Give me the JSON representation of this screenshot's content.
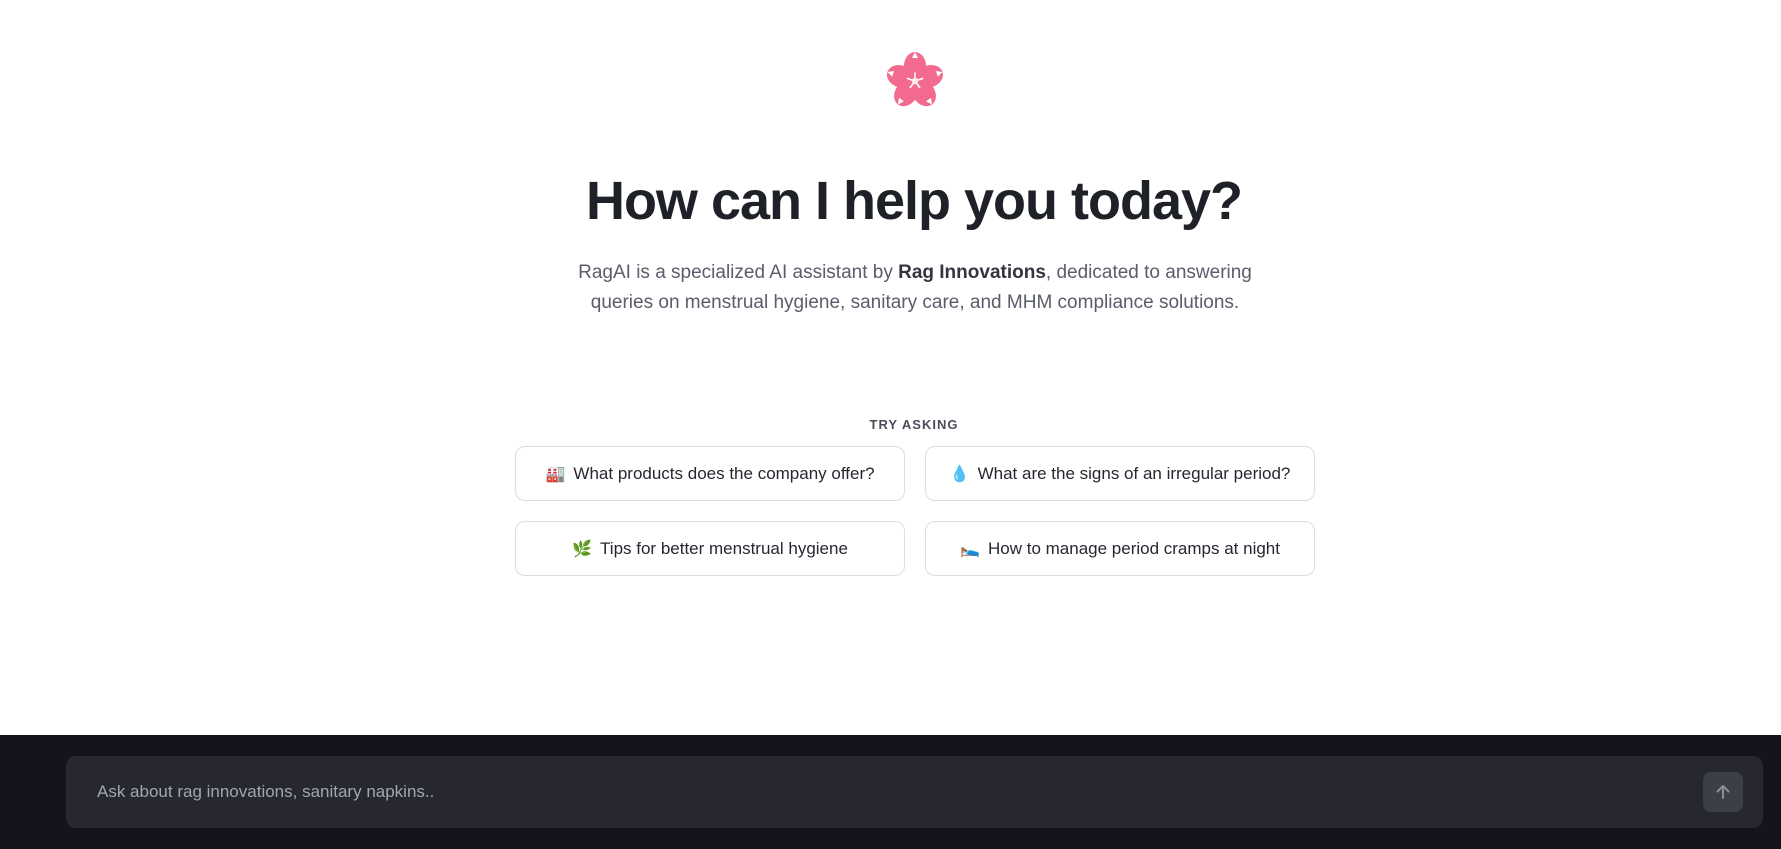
{
  "hero": {
    "logo_icon": "cherry-blossom-icon",
    "logo_color": "#f26a8d",
    "title": "How can I help you today?",
    "subtitle_prefix": "RagAI is a specialized AI assistant by ",
    "subtitle_brand": "Rag Innovations",
    "subtitle_suffix": ", dedicated to answering queries on menstrual hygiene, sanitary care, and MHM compliance solutions."
  },
  "suggestions": {
    "label": "TRY ASKING",
    "items": [
      {
        "icon": "factory-icon",
        "glyph": "🏭",
        "text": "What products does the company offer?"
      },
      {
        "icon": "droplet-icon",
        "glyph": "💧",
        "text": "What are the signs of an irregular period?"
      },
      {
        "icon": "herb-icon",
        "glyph": "🌿",
        "text": "Tips for better menstrual hygiene"
      },
      {
        "icon": "bed-icon",
        "glyph": "🛌",
        "text": "How to manage period cramps at night"
      }
    ]
  },
  "chat": {
    "placeholder": "Ask about rag innovations, sanitary napkins..",
    "send_icon": "arrow-up-icon"
  },
  "colors": {
    "footer_bg": "#14151c",
    "input_bg": "#262730",
    "accent_pink": "#f26a8d"
  }
}
